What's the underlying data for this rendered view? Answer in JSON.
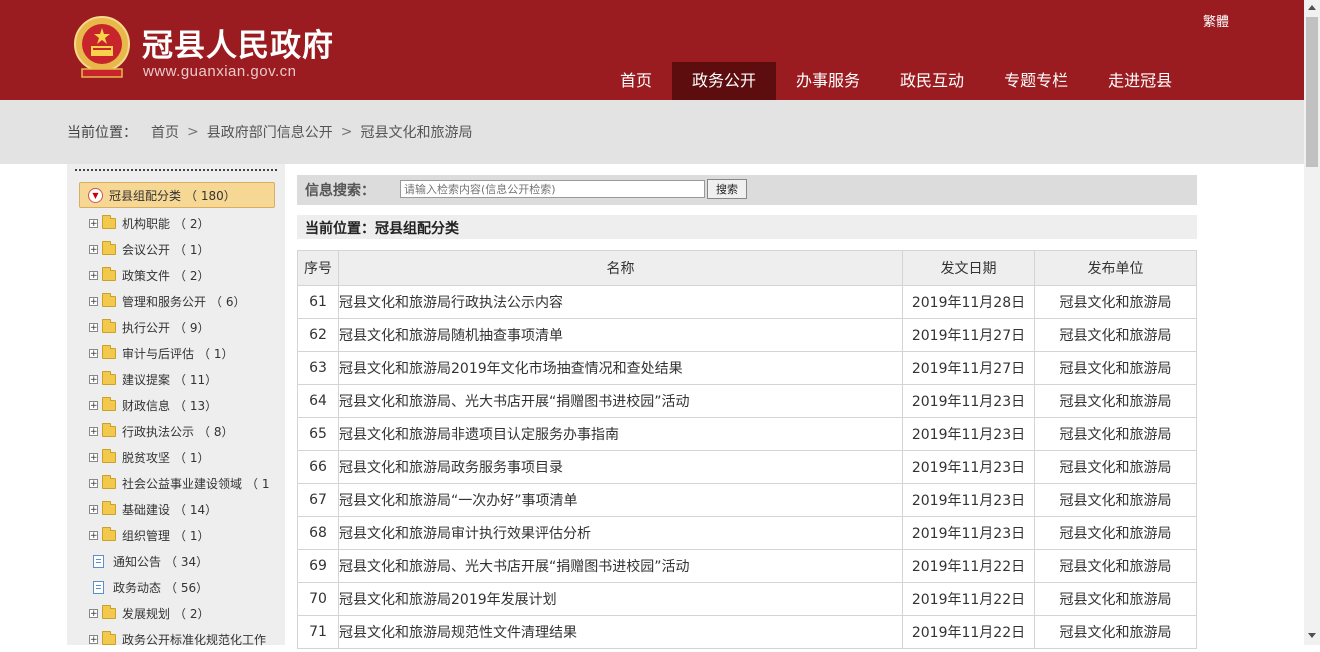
{
  "header": {
    "title": "冠县人民政府",
    "url": "www.guanxian.gov.cn",
    "traditional_link": "繁體",
    "emblem_icon": "national-emblem-icon",
    "nav": [
      {
        "label": "首页",
        "active": false
      },
      {
        "label": "政务公开",
        "active": true
      },
      {
        "label": "办事服务",
        "active": false
      },
      {
        "label": "政民互动",
        "active": false
      },
      {
        "label": "专题专栏",
        "active": false
      },
      {
        "label": "走进冠县",
        "active": false
      }
    ],
    "colors": {
      "header_bg": "#9b1c20",
      "nav_active_bg": "#5e0d0f"
    }
  },
  "breadcrumb": {
    "label": "当前位置：",
    "items": [
      "首页",
      "县政府部门信息公开",
      "冠县文化和旅游局"
    ]
  },
  "sidebar": {
    "root": {
      "label": "冠县组配分类",
      "count": "（ 180）"
    },
    "items": [
      {
        "label": "机构职能",
        "count": "（ 2）",
        "type": "folder"
      },
      {
        "label": "会议公开",
        "count": "（ 1）",
        "type": "folder"
      },
      {
        "label": "政策文件",
        "count": "（ 2）",
        "type": "folder"
      },
      {
        "label": "管理和服务公开",
        "count": "（ 6）",
        "type": "folder"
      },
      {
        "label": "执行公开",
        "count": "（ 9）",
        "type": "folder"
      },
      {
        "label": "审计与后评估",
        "count": "（ 1）",
        "type": "folder"
      },
      {
        "label": "建议提案",
        "count": "（ 11）",
        "type": "folder"
      },
      {
        "label": "财政信息",
        "count": "（ 13）",
        "type": "folder"
      },
      {
        "label": "行政执法公示",
        "count": "（ 8）",
        "type": "folder"
      },
      {
        "label": "脱贫攻坚",
        "count": "（ 1）",
        "type": "folder"
      },
      {
        "label": "社会公益事业建设领域",
        "count": "（ 1",
        "type": "folder"
      },
      {
        "label": "基础建设",
        "count": "（ 14）",
        "type": "folder"
      },
      {
        "label": "组织管理",
        "count": "（ 1）",
        "type": "folder"
      },
      {
        "label": "通知公告",
        "count": "（ 34）",
        "type": "doc"
      },
      {
        "label": "政务动态",
        "count": "（ 56）",
        "type": "doc"
      },
      {
        "label": "发展规划",
        "count": "（ 2）",
        "type": "folder"
      },
      {
        "label": "政务公开标准化规范化工作",
        "count": "",
        "type": "folder"
      }
    ]
  },
  "search": {
    "label": "信息搜索：",
    "placeholder": "请输入检索内容(信息公开检索)",
    "button": "搜索"
  },
  "section": {
    "title": "当前位置：冠县组配分类"
  },
  "table": {
    "headers": [
      "序号",
      "名称",
      "发文日期",
      "发布单位"
    ],
    "rows": [
      {
        "no": "61",
        "name": "冠县文化和旅游局行政执法公示内容",
        "date": "2019年11月28日",
        "unit": "冠县文化和旅游局"
      },
      {
        "no": "62",
        "name": "冠县文化和旅游局随机抽查事项清单",
        "date": "2019年11月27日",
        "unit": "冠县文化和旅游局"
      },
      {
        "no": "63",
        "name": "冠县文化和旅游局2019年文化市场抽查情况和查处结果",
        "date": "2019年11月27日",
        "unit": "冠县文化和旅游局"
      },
      {
        "no": "64",
        "name": "冠县文化和旅游局、光大书店开展“捐赠图书进校园”活动",
        "date": "2019年11月23日",
        "unit": "冠县文化和旅游局"
      },
      {
        "no": "65",
        "name": "冠县文化和旅游局非遗项目认定服务办事指南",
        "date": "2019年11月23日",
        "unit": "冠县文化和旅游局"
      },
      {
        "no": "66",
        "name": "冠县文化和旅游局政务服务事项目录",
        "date": "2019年11月23日",
        "unit": "冠县文化和旅游局"
      },
      {
        "no": "67",
        "name": "冠县文化和旅游局“一次办好”事项清单",
        "date": "2019年11月23日",
        "unit": "冠县文化和旅游局"
      },
      {
        "no": "68",
        "name": "冠县文化和旅游局审计执行效果评估分析",
        "date": "2019年11月23日",
        "unit": "冠县文化和旅游局"
      },
      {
        "no": "69",
        "name": "冠县文化和旅游局、光大书店开展“捐赠图书进校园”活动",
        "date": "2019年11月22日",
        "unit": "冠县文化和旅游局"
      },
      {
        "no": "70",
        "name": "冠县文化和旅游局2019年发展计划",
        "date": "2019年11月22日",
        "unit": "冠县文化和旅游局"
      },
      {
        "no": "71",
        "name": "冠县文化和旅游局规范性文件清理结果",
        "date": "2019年11月22日",
        "unit": "冠县文化和旅游局"
      }
    ]
  }
}
